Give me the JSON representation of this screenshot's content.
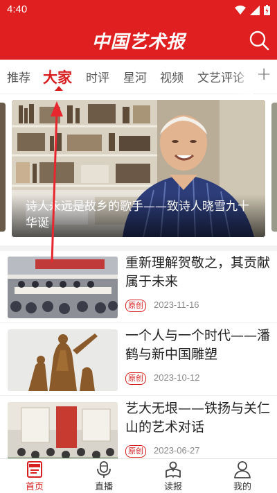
{
  "status": {
    "time": "4:40"
  },
  "app": {
    "logo_text": "中国艺术报",
    "brand_color": "#e02020"
  },
  "tabs": [
    {
      "label": "推荐",
      "active": false
    },
    {
      "label": "大家",
      "active": true
    },
    {
      "label": "时评",
      "active": false
    },
    {
      "label": "星河",
      "active": false
    },
    {
      "label": "视频",
      "active": false
    },
    {
      "label": "文艺评论",
      "active": false
    }
  ],
  "tab_more_icon": "plus-icon",
  "banner": {
    "caption": "诗人永远是故乡的歌手——致诗人晓雪九十华诞"
  },
  "news": [
    {
      "title": "重新理解贺敬之，其贡献属于未来",
      "tag": "原创",
      "date": "2023-11-16"
    },
    {
      "title": "一个人与一个时代——潘鹤与新中国雕塑",
      "tag": "原创",
      "date": "2023-10-12"
    },
    {
      "title": "艺大无垠——铁扬与关仁山的艺术对话",
      "tag": "原创",
      "date": "2023-06-27"
    }
  ],
  "bottom_nav": [
    {
      "label": "首页",
      "icon": "news-icon",
      "active": true
    },
    {
      "label": "直播",
      "icon": "microphone-icon",
      "active": false
    },
    {
      "label": "读报",
      "icon": "reader-icon",
      "active": false
    },
    {
      "label": "我的",
      "icon": "user-icon",
      "active": false
    }
  ]
}
